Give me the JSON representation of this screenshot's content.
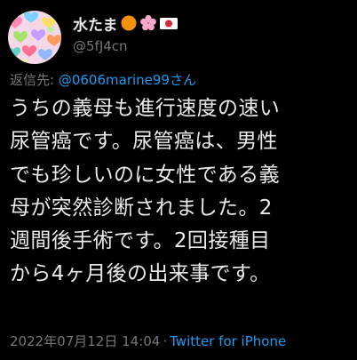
{
  "author": {
    "display_name": "水たま",
    "emoji_icons": [
      "orange-circle-icon",
      "cherry-blossom-icon",
      "japan-flag-icon"
    ],
    "handle": "@5fJ4cn"
  },
  "reply": {
    "label": "返信先:",
    "target": "@0606marine99さん"
  },
  "body": {
    "lines": [
      "うちの義母も進行速度の速い",
      "尿管癌です。尿管癌は、男性",
      "でも珍しいのに女性である義",
      "母が突然診断されました。2",
      "週間後手術です。2回接種目",
      "から4ヶ月後の出来事です。"
    ]
  },
  "meta": {
    "timestamp": "2022年07月12日 14:04",
    "separator": "·",
    "source": "Twitter for iPhone"
  },
  "colors": {
    "background": "#000000",
    "text_primary": "#e7e9ea",
    "text_secondary": "#71767b",
    "accent_link": "#1d9bf0"
  }
}
